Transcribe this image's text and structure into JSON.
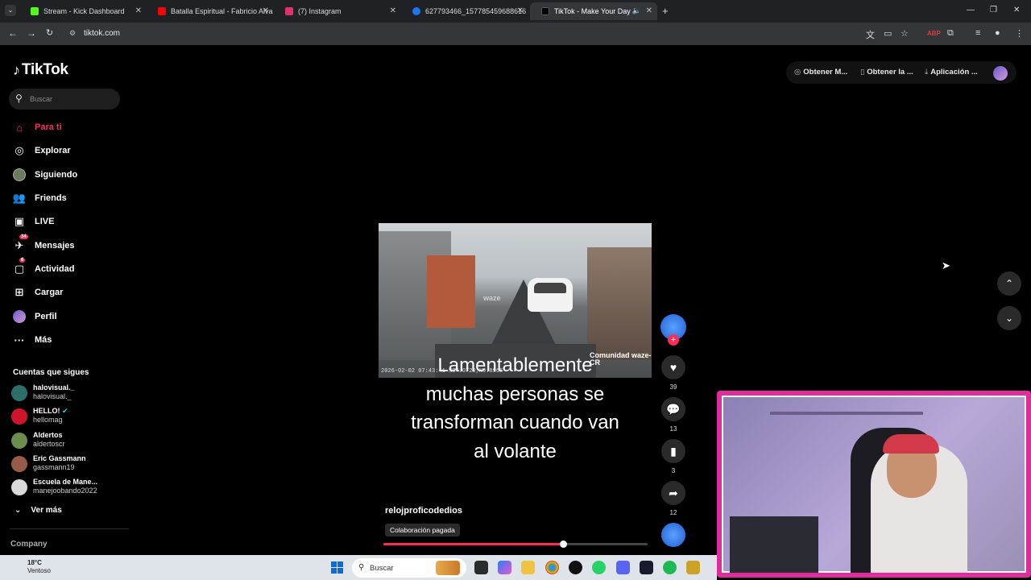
{
  "browser": {
    "tabs": [
      {
        "title": "Stream - Kick Dashboard",
        "fav": "#53fc18"
      },
      {
        "title": "Batalla Espiritual - Fabricio Alva",
        "fav": "#ff0000"
      },
      {
        "title": "(7) Instagram",
        "fav": "#e1306c"
      },
      {
        "title": "627793466_157785459688616",
        "fav": "#1877f2"
      },
      {
        "title": "TikTok - Make Your Day",
        "fav": "#000000"
      }
    ],
    "url": "tiktok.com"
  },
  "header": {
    "logo": "TikTok",
    "search_placeholder": "Buscar",
    "buttons": [
      "Obtener M...",
      "Obtener la ...",
      "Aplicación ..."
    ]
  },
  "sidebar": {
    "items": [
      {
        "label": "Para ti",
        "icon": "home-icon",
        "active": true
      },
      {
        "label": "Explorar",
        "icon": "compass-icon"
      },
      {
        "label": "Siguiendo",
        "icon": "following-avatar-icon"
      },
      {
        "label": "Friends",
        "icon": "friends-icon"
      },
      {
        "label": "LIVE",
        "icon": "live-icon"
      },
      {
        "label": "Mensajes",
        "icon": "message-icon",
        "badge": "34"
      },
      {
        "label": "Actividad",
        "icon": "activity-icon",
        "badge": "6"
      },
      {
        "label": "Cargar",
        "icon": "upload-icon"
      },
      {
        "label": "Perfil",
        "icon": "profile-avatar-icon"
      },
      {
        "label": "Más",
        "icon": "more-icon"
      }
    ],
    "following_title": "Cuentas que sigues",
    "following": [
      {
        "name": "halovisual._",
        "user": "halovisual._",
        "color": "#2c6e6a"
      },
      {
        "name": "HELLO!",
        "user": "hellomag",
        "color": "#d0142c"
      },
      {
        "name": "Aldertos",
        "user": "aldertoscr",
        "color": "#6b8e4e"
      },
      {
        "name": "Eric Gassmann",
        "user": "gassmann19",
        "color": "#9a5c4a"
      },
      {
        "name": "Escuela de Mane...",
        "user": "manejoobando2022",
        "color": "#d9d9d9"
      }
    ],
    "see_more": "Ver más",
    "company": "Company"
  },
  "video": {
    "timestamp": "2026-02-02 07:43:41  N84.0720,N9.8966",
    "watermark": "Comunidad waze-CR",
    "caption_lines": [
      "Lamentablemente",
      "muchas personas se",
      "transforman cuando van",
      "al volante"
    ],
    "author": "relojproficodedios",
    "tag": "Colaboración pagada",
    "progress": 0.68
  },
  "actions": {
    "likes": "39",
    "comments": "13",
    "saves": "3",
    "shares": "12"
  },
  "taskbar": {
    "temperature": "18°C",
    "condition": "Ventoso",
    "search": "Buscar"
  }
}
